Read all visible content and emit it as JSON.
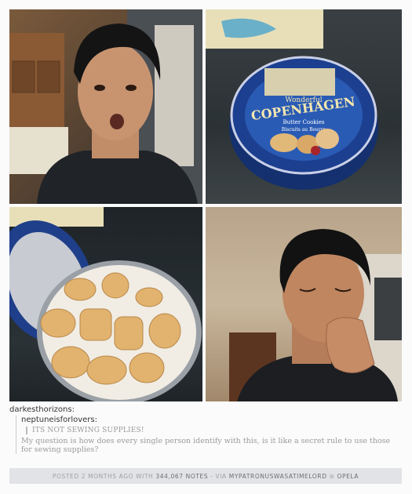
{
  "post": {
    "photos": [
      {
        "name": "photo-surprised-face"
      },
      {
        "name": "photo-cookie-tin-closed"
      },
      {
        "name": "photo-cookie-tin-open"
      },
      {
        "name": "photo-crying-face"
      }
    ],
    "tin_text": {
      "brand_small": "Wonderful",
      "brand_large": "COPENHAGEN",
      "subtitle": "Butter Cookies",
      "subtitle2": "Biscuits au Beurre"
    }
  },
  "caption": {
    "poster": "darkesthorizons:",
    "reblog_user": "neptuneisforlovers:",
    "quote": "ITS NOT SEWING SUPPLIES!",
    "question": "My question is how does every single person identify with this, is it like a secret rule to use those for sewing supplies?"
  },
  "footer": {
    "prefix": "POSTED 2 MONTHS AGO WITH",
    "notes": "344,067 NOTES",
    "via_label": "- VIA",
    "via_user": "MYPATRONUSWASATIMELORD",
    "sep": "⊚",
    "source_user": "OPELA"
  }
}
